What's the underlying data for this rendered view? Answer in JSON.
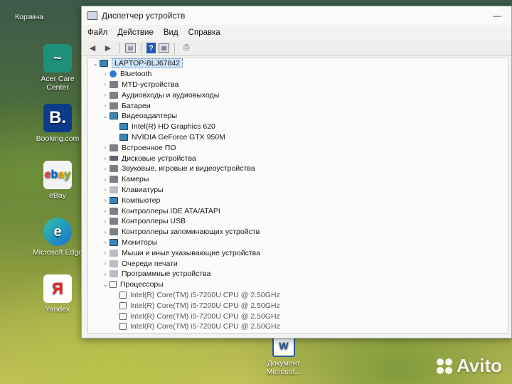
{
  "desktop": {
    "recycle_bin": "Корзина",
    "icons": [
      {
        "id": "acer",
        "label": "Acer Care Center",
        "glyph": "~"
      },
      {
        "id": "booking",
        "label": "Booking.com",
        "glyph": "B."
      },
      {
        "id": "ebay",
        "label": "eBay",
        "glyph": "ebay"
      },
      {
        "id": "edge",
        "label": "Microsoft Edge",
        "glyph": "e"
      },
      {
        "id": "yandex",
        "label": "Yandex",
        "glyph": "Я"
      },
      {
        "id": "word",
        "label": "Документ Microsof...",
        "glyph": "W"
      }
    ],
    "watermark": "Avito"
  },
  "window": {
    "title": "Диспетчер устройств",
    "menu": [
      "Файл",
      "Действие",
      "Вид",
      "Справка"
    ],
    "controls": {
      "minimize": "—"
    },
    "toolbar": {
      "back": "◀",
      "forward": "▶",
      "props": "▤",
      "help": "?",
      "view": "▦",
      "scan": "⎙"
    }
  },
  "tree": {
    "root": "LAPTOP-BLJ67842",
    "expanded_arrow": "⌄",
    "collapsed_arrow": "›",
    "categories": [
      {
        "label": "Bluetooth",
        "icon": "bluetooth-icon",
        "expanded": false
      },
      {
        "label": "MTD-устройства",
        "icon": "mtd-icon",
        "expanded": false
      },
      {
        "label": "Аудиовходы и аудиовыходы",
        "icon": "audio-icon",
        "expanded": false
      },
      {
        "label": "Батареи",
        "icon": "battery-icon",
        "expanded": false
      },
      {
        "label": "Видеоадаптеры",
        "icon": "display-adapter-icon",
        "expanded": true,
        "children": [
          "Intel(R) HD Graphics 620",
          "NVIDIA GeForce GTX 950M"
        ]
      },
      {
        "label": "Встроенное ПО",
        "icon": "firmware-icon",
        "expanded": false
      },
      {
        "label": "Дисковые устройства",
        "icon": "disk-icon",
        "expanded": false
      },
      {
        "label": "Звуковые, игровые и видеоустройства",
        "icon": "sound-icon",
        "expanded": false
      },
      {
        "label": "Камеры",
        "icon": "camera-icon",
        "expanded": false
      },
      {
        "label": "Клавиатуры",
        "icon": "keyboard-icon",
        "expanded": false
      },
      {
        "label": "Компьютер",
        "icon": "computer-icon",
        "expanded": false
      },
      {
        "label": "Контроллеры IDE ATA/ATAPI",
        "icon": "ide-icon",
        "expanded": false
      },
      {
        "label": "Контроллеры USB",
        "icon": "usb-icon",
        "expanded": false
      },
      {
        "label": "Контроллеры запоминающих устройств",
        "icon": "storage-icon",
        "expanded": false
      },
      {
        "label": "Мониторы",
        "icon": "monitor-icon",
        "expanded": false
      },
      {
        "label": "Мыши и иные указывающие устройства",
        "icon": "mouse-icon",
        "expanded": false
      },
      {
        "label": "Очереди печати",
        "icon": "printer-icon",
        "expanded": false
      },
      {
        "label": "Программные устройства",
        "icon": "software-device-icon",
        "expanded": false
      },
      {
        "label": "Процессоры",
        "icon": "processor-icon",
        "expanded": true,
        "children": [
          "Intel(R) Core(TM) i5-7200U CPU @ 2.50GHz",
          "Intel(R) Core(TM) i5-7200U CPU @ 2.50GHz",
          "Intel(R) Core(TM) i5-7200U CPU @ 2.50GHz",
          "Intel(R) Core(TM) i5-7200U CPU @ 2.50GHz"
        ]
      }
    ]
  }
}
